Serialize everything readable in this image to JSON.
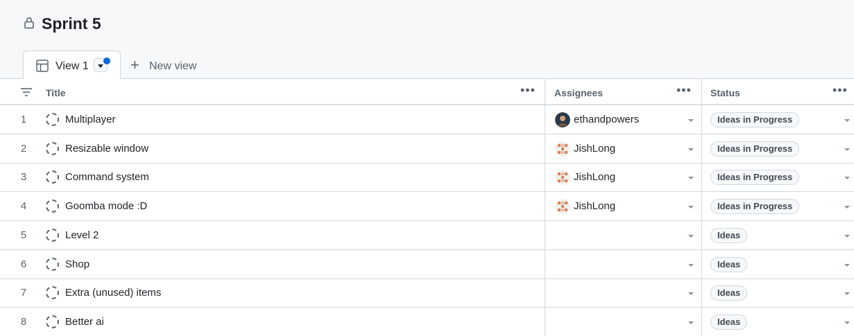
{
  "project": {
    "title": "Sprint 5",
    "lock_icon": "lock-icon"
  },
  "views": {
    "tabs": [
      {
        "label": "View 1",
        "icon": "table-icon",
        "has_unsaved_dot": true,
        "dot_color": "#0969da"
      }
    ],
    "new_view_label": "New view"
  },
  "columns": {
    "title": "Title",
    "assignees": "Assignees",
    "status": "Status"
  },
  "rows": [
    {
      "num": "1",
      "title": "Multiplayer",
      "assignee": "ethandpowers",
      "status": "Ideas in Progress"
    },
    {
      "num": "2",
      "title": "Resizable window",
      "assignee": "JishLong",
      "status": "Ideas in Progress"
    },
    {
      "num": "3",
      "title": "Command system",
      "assignee": "JishLong",
      "status": "Ideas in Progress"
    },
    {
      "num": "4",
      "title": "Goomba mode :D",
      "assignee": "JishLong",
      "status": "Ideas in Progress"
    },
    {
      "num": "5",
      "title": "Level 2",
      "assignee": "",
      "status": "Ideas"
    },
    {
      "num": "6",
      "title": "Shop",
      "assignee": "",
      "status": "Ideas"
    },
    {
      "num": "7",
      "title": "Extra (unused) items",
      "assignee": "",
      "status": "Ideas"
    },
    {
      "num": "8",
      "title": "Better ai",
      "assignee": "",
      "status": "Ideas"
    }
  ],
  "colors": {
    "accent": "#0969da",
    "border": "#d0d7de",
    "header_bg": "#f6f8fa"
  }
}
